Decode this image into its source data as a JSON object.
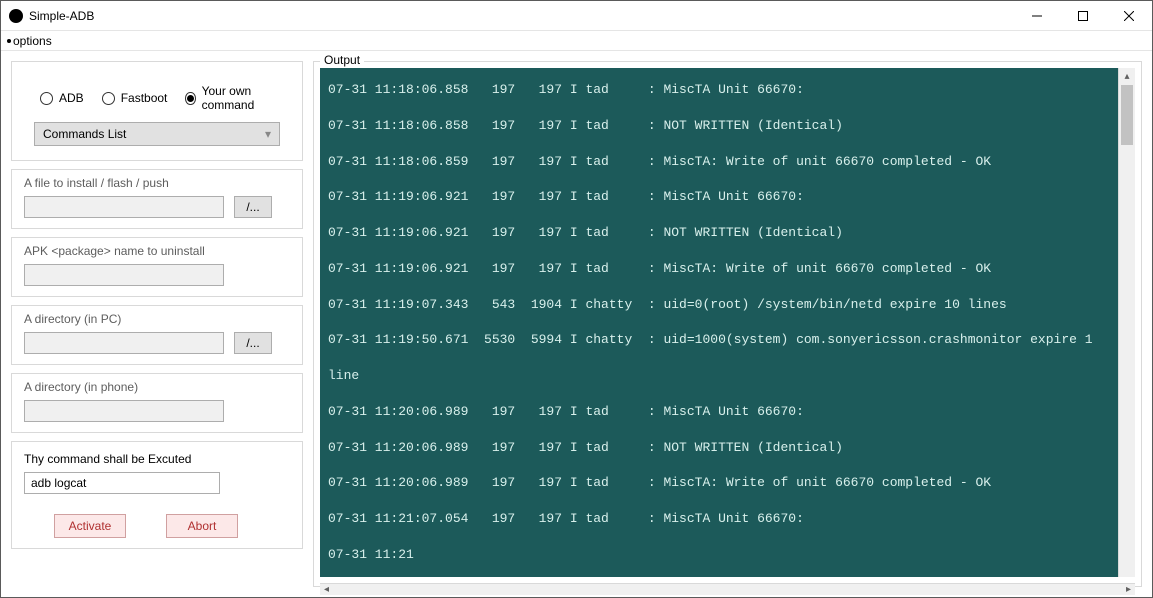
{
  "window": {
    "title": "Simple-ADB"
  },
  "menu": {
    "options": "options"
  },
  "left": {
    "radios": {
      "adb": "ADB",
      "fastboot": "Fastboot",
      "own": "Your own command",
      "selected": "own"
    },
    "commands_list": "Commands List",
    "file_label": "A file to install / flash / push",
    "file_value": "",
    "browse": "/...",
    "apk_label": "APK <package> name to uninstall",
    "apk_value": "",
    "dir_pc_label": "A directory (in PC)",
    "dir_pc_value": "",
    "dir_phone_label": "A directory (in phone)",
    "dir_phone_value": "",
    "cmd_title": "Thy command shall be Excuted",
    "cmd_value": "adb logcat",
    "activate": "Activate",
    "abort": "Abort"
  },
  "output": {
    "label": "Output",
    "lines": [
      "07-31 11:18:06.858   197   197 I tad     : MiscTA Unit 66670:",
      "07-31 11:18:06.858   197   197 I tad     : NOT WRITTEN (Identical)",
      "07-31 11:18:06.859   197   197 I tad     : MiscTA: Write of unit 66670 completed - OK",
      "07-31 11:19:06.921   197   197 I tad     : MiscTA Unit 66670:",
      "07-31 11:19:06.921   197   197 I tad     : NOT WRITTEN (Identical)",
      "07-31 11:19:06.921   197   197 I tad     : MiscTA: Write of unit 66670 completed - OK",
      "07-31 11:19:07.343   543  1904 I chatty  : uid=0(root) /system/bin/netd expire 10 lines",
      "07-31 11:19:50.671  5530  5994 I chatty  : uid=1000(system) com.sonyericsson.crashmonitor expire 1 line",
      "07-31 11:20:06.989   197   197 I tad     : MiscTA Unit 66670:",
      "07-31 11:20:06.989   197   197 I tad     : NOT WRITTEN (Identical)",
      "07-31 11:20:06.989   197   197 I tad     : MiscTA: Write of unit 66670 completed - OK",
      "07-31 11:21:07.054   197   197 I tad     : MiscTA Unit 66670:",
      "07-31 11:21"
    ]
  }
}
